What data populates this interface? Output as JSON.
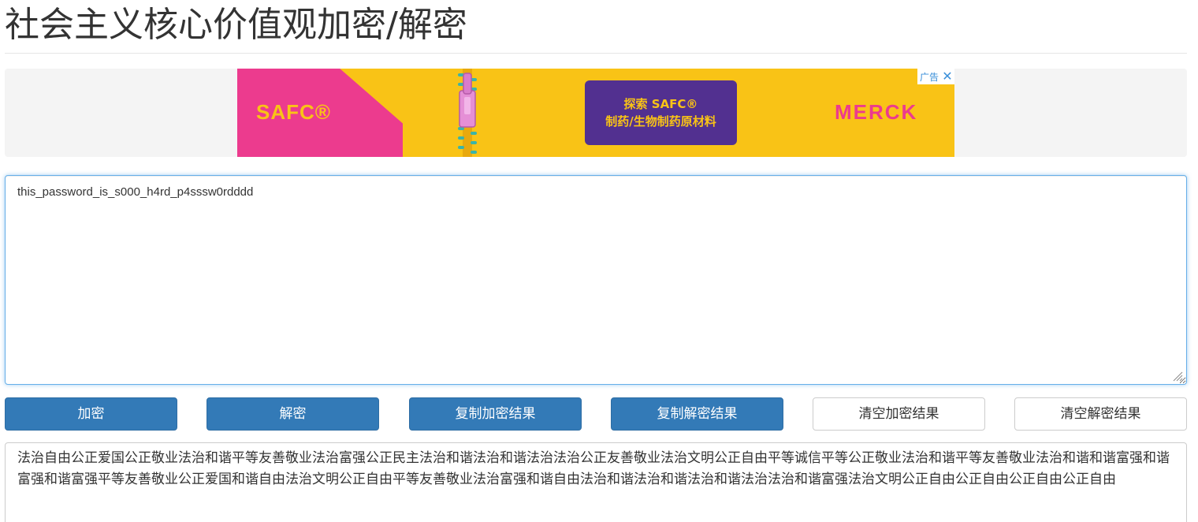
{
  "page": {
    "title": "社会主义核心价值观加密/解密"
  },
  "ad": {
    "brand_left": "SAFC®",
    "cta_line1": "探索 SAFC®",
    "cta_line2": "制药/生物制药原材料",
    "brand_right": "MERCK",
    "badge_label": "广告",
    "close_glyph": "✕",
    "colors": {
      "background": "#f9c316",
      "pink": "#ec3b8e",
      "purple": "#523090"
    }
  },
  "input": {
    "value": "this_password_is_s000_h4rd_p4sssw0rdddd"
  },
  "buttons": {
    "encrypt": "加密",
    "decrypt": "解密",
    "copy_encrypt": "复制加密结果",
    "copy_decrypt": "复制解密结果",
    "clear_encrypt": "清空加密结果",
    "clear_decrypt": "清空解密结果"
  },
  "output": {
    "value": "法治自由公正爱国公正敬业法治和谐平等友善敬业法治富强公正民主法治和谐法治和谐法治法治公正友善敬业法治文明公正自由平等诚信平等公正敬业法治和谐平等友善敬业法治和谐和谐富强和谐富强和谐富强平等友善敬业公正爱国和谐自由法治文明公正自由平等友善敬业法治富强和谐自由法治和谐法治和谐法治和谐法治法治和谐富强法治文明公正自由公正自由公正自由公正自由"
  },
  "colors": {
    "primary": "#337ab7",
    "focus_border": "#66afe9"
  }
}
